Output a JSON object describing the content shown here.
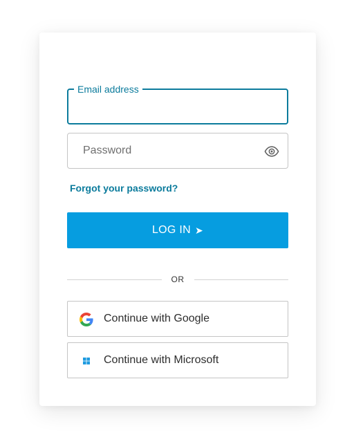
{
  "form": {
    "email": {
      "label": "Email address",
      "value": "",
      "placeholder": ""
    },
    "password": {
      "value": "",
      "placeholder": "Password"
    },
    "forgot_link": "Forgot your password?",
    "login_button": {
      "label": "LOG IN",
      "arrow": "➤"
    },
    "divider_text": "OR"
  },
  "social": {
    "google": {
      "label": "Continue with Google",
      "icon": "google-logo-icon"
    },
    "microsoft": {
      "label": "Continue with Microsoft",
      "icon": "windows-logo-icon"
    }
  },
  "colors": {
    "accent": "#069de0",
    "link": "#0b7b9c",
    "focus_border": "#0b7b9c",
    "border": "#c4c4c4",
    "text": "#2d2d2d"
  }
}
